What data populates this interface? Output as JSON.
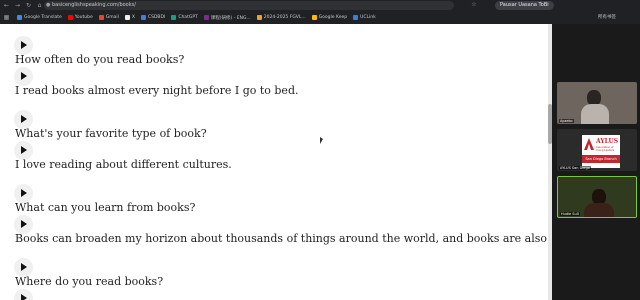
{
  "browser": {
    "url": "basicenglishspeaking.com/books/",
    "pause_label": "Pausar Uasana ToBi",
    "bookmarks": [
      {
        "label": "Google Translate",
        "color": "#4285f4"
      },
      {
        "label": "Youtube",
        "color": "#ff0000"
      },
      {
        "label": "Gmail",
        "color": "#ea4335"
      },
      {
        "label": "X",
        "color": "#111111"
      },
      {
        "label": "CSDBDI",
        "color": "#4a7bd0"
      },
      {
        "label": "ChatGPT",
        "color": "#10a37f"
      },
      {
        "label": "课程(研修) - ENG...",
        "color": "#7b2d8b"
      },
      {
        "label": "2024-2025 FGVL...",
        "color": "#e8a52b"
      },
      {
        "label": "Google Keep",
        "color": "#fbbc04"
      },
      {
        "label": "UCLink",
        "color": "#3b7dd8"
      }
    ],
    "all_bookmarks": "所有书签"
  },
  "content": {
    "lines": [
      "How often do you read books?",
      "I read books almost every night before I go to bed.",
      "What's your favorite type of book?",
      "I love reading about different cultures.",
      "What can you learn from books?",
      "Books can broaden my horizon about thousands of things around the world, and books are also my best friends.",
      "Where do you read books?"
    ]
  },
  "sidebar": {
    "tiles": [
      {
        "name": "Ayaeko"
      },
      {
        "name": "AYLUS San Diego",
        "logo_title": "AYLUS",
        "logo_sub": "Association of Young Leaders",
        "logo_band": "San Diego Branch"
      },
      {
        "name": "Hudie Su0"
      }
    ]
  },
  "colors": {
    "logo_red": "#c0282d",
    "active_tile_border": "#7cc63c"
  }
}
